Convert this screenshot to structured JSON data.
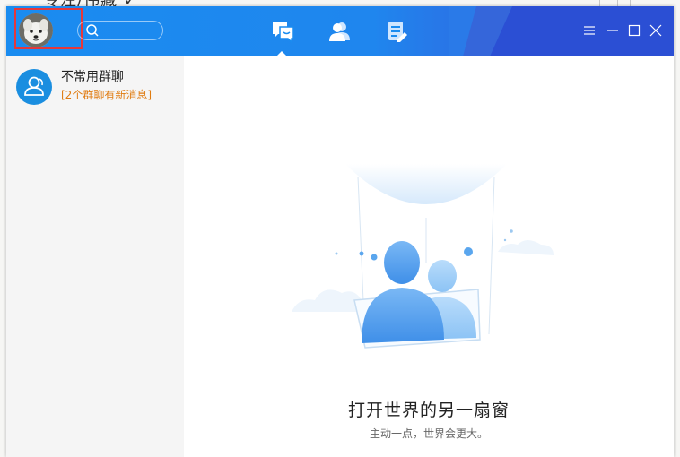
{
  "background": {
    "title": "专注/伟藏 ✓"
  },
  "colors": {
    "titlebar": "#1a8cf0",
    "titlebar_dark": "#2b4fd4",
    "accent": "#1a8ee0",
    "notice": "#e07b10",
    "highlight_border": "#e5383b"
  },
  "titlebar": {
    "avatar_icon": "user-avatar-dog",
    "search_icon": "search-icon",
    "tabs": [
      {
        "name": "messages",
        "icon": "chat-bubble-icon",
        "active": true
      },
      {
        "name": "contacts",
        "icon": "contacts-icon",
        "active": false
      },
      {
        "name": "notes",
        "icon": "document-icon",
        "active": false
      }
    ],
    "window_buttons": [
      "menu-icon",
      "minimize-icon",
      "maximize-icon",
      "close-icon"
    ]
  },
  "sidebar": {
    "items": [
      {
        "title": "不常用群聊",
        "subtitle": "[2个群聊有新消息]",
        "icon": "group-chat-icon"
      }
    ]
  },
  "main": {
    "title": "打开世界的另一扇窗",
    "subtitle": "主动一点，世界会更大。"
  }
}
